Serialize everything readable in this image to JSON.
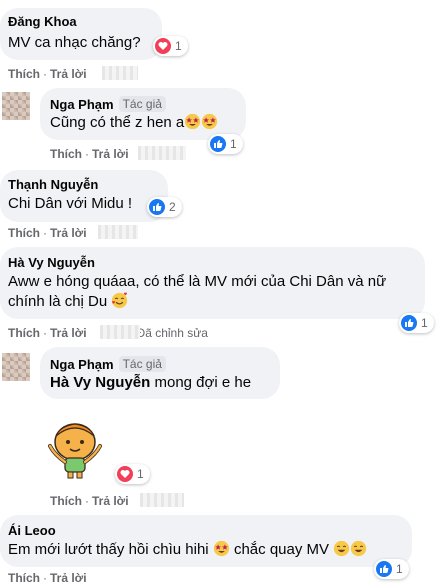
{
  "comments": [
    {
      "author": "Đăng Khoa",
      "text": "MV ca nhạc chăng?",
      "reaction": {
        "type": "love",
        "count": "1"
      },
      "actions": {
        "like": "Thích",
        "reply": "Trả lời"
      }
    },
    {
      "author": "Nga Phạm",
      "badge": "Tác giả",
      "text": "Cũng có thể z hen a",
      "reaction": {
        "type": "like",
        "count": "1"
      },
      "actions": {
        "like": "Thích",
        "reply": "Trả lời"
      }
    },
    {
      "author": "Thạnh Nguyễn",
      "text": "Chi Dân với Midu !",
      "reaction": {
        "type": "like",
        "count": "2"
      },
      "actions": {
        "like": "Thích",
        "reply": "Trả lời"
      }
    },
    {
      "author": "Hà Vy Nguyễn",
      "text_line1": "Aww e hóng quáaa, có thể là MV mới của Chi Dân và nữ",
      "text_line2": "chính là chị Du",
      "reaction": {
        "type": "like",
        "count": "1"
      },
      "actions": {
        "like": "Thích",
        "reply": "Trả lời",
        "edited": "Đã chỉnh sửa"
      }
    },
    {
      "author": "Nga Phạm",
      "badge": "Tác giả",
      "mention": "Hà Vy Nguyễn",
      "text": " mong đợi e he",
      "sticker": "waving-kid-sticker",
      "reaction": {
        "type": "love",
        "count": "1"
      },
      "actions": {
        "like": "Thích",
        "reply": "Trả lời"
      }
    },
    {
      "author": "Ái Leoo",
      "text": "Em mới lướt thấy hồi chìu hihi",
      "text_tail": " chắc quay MV",
      "reaction": {
        "type": "like",
        "count": "1"
      },
      "actions": {
        "like": "Thích",
        "reply": "Trả lời"
      }
    }
  ],
  "colors": {
    "bubble": "#f0f2f5",
    "like": "#1877f2",
    "love": "#f33e58",
    "meta": "#65676b"
  }
}
